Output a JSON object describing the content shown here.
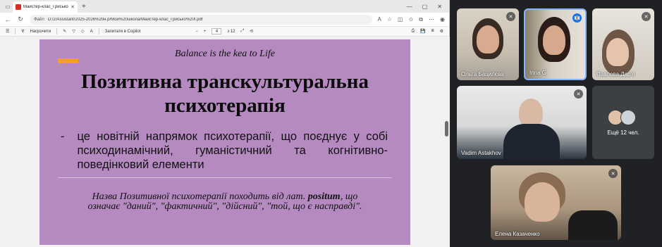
{
  "browser": {
    "tab_title": "Майстер-клас_Грисько І.pdf",
    "url_scheme": "Файл",
    "url": "D:/2/Assistant/2025-2026%20н.р/Мой%20школа/Майстер-клас_Грисько%20І.pdf",
    "pdf_toolbar": {
      "read_aloud": "Насрочити",
      "ask_copilot": "Запитати в Copilot",
      "page_current": "4",
      "page_total": "з 12"
    }
  },
  "slide": {
    "subtitle": "Balance is the kea to Life",
    "title": "Позитивна транскультуральна психотерапія",
    "bullet_dash": "-",
    "bullet_text": "це новітній напрямок психотерапії, що поєднує у собі психодинамічний, гуманістичний та когнітивно-поведінковий елементи",
    "note_prefix": "Назва Позитивної психотерапії походить від лат.",
    "note_bold": "positum",
    "note_suffix": ", що означає \"даний\", \"фактичний\", \"дійсний\", \"той, що є насправді\"."
  },
  "participants": [
    {
      "name": "Ольга Бацилєва"
    },
    {
      "name": "Inna G"
    },
    {
      "name": "Павлова Дар'я"
    },
    {
      "name": "Vadim Astakhov"
    },
    {
      "name": "Елена Казаченко"
    }
  ],
  "more_participants": "Ещё 12 чел.",
  "colors": {
    "slide_bg": "#b48ac0",
    "accent": "#f0a41e",
    "speaking_border": "#8ab4f8"
  }
}
